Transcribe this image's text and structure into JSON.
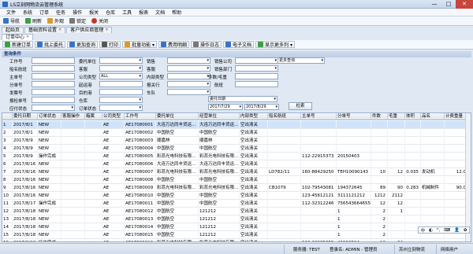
{
  "window": {
    "title": "LS立刻网物流云管理系统",
    "min": "—",
    "max": "□",
    "close": "✕"
  },
  "menu": [
    "文件",
    "系统",
    "订单",
    "任务",
    "操作",
    "报关",
    "仓库",
    "工具",
    "报表",
    "文档",
    "帮助"
  ],
  "quickbar": [
    {
      "label": "导航",
      "color": "#3a73c4"
    },
    {
      "label": "刷新",
      "color": "#3aa044"
    },
    {
      "label": "外观",
      "color": "#d99a2b"
    },
    {
      "label": "锁定",
      "color": "#777777"
    },
    {
      "label": "关闭",
      "color": "#c0392b"
    }
  ],
  "tabs_top": [
    {
      "label": "起始页",
      "closable": false
    },
    {
      "label": "基础资料设置",
      "closable": true
    },
    {
      "label": "客户供应商管理",
      "closable": true
    },
    {
      "label": "订单中心",
      "closable": true
    }
  ],
  "toolbar": [
    {
      "label": "新建订单",
      "color": "#3aa044"
    },
    {
      "label": "找上委托",
      "color": "#3a73c4"
    },
    {
      "label": "更加查询",
      "color": "#3a73c4"
    },
    {
      "label": "打印",
      "color": "#555555"
    },
    {
      "label": "批量功能 ▾",
      "color": "#d99a2b"
    },
    {
      "label": "费用明细",
      "color": "#3a73c4"
    },
    {
      "label": "操作日志",
      "color": "#777777"
    },
    {
      "label": "电子文档",
      "color": "#3a73c4"
    },
    {
      "label": "显示更多列 ▾",
      "color": "#3aa044"
    }
  ],
  "section_title": "查询条件",
  "form": {
    "labels": {
      "work_no": "工作号",
      "cust_short": "船名航班",
      "main_no": "主单号",
      "sub_no": "分单号",
      "tracking": "发票号",
      "decl_no": "报检单号",
      "sales": "应付状态",
      "consignor": "委托单位",
      "partner": "客服",
      "company_type": "公司类型",
      "origin_port": "起运港",
      "dest_port": "目的港",
      "warehouse": "仓库",
      "order_status": "订单状态",
      "sales_person": "销售",
      "operator": "客服",
      "inner_type": "内部类型",
      "decl_bank": "报关行",
      "vehicle": "车队",
      "sales_co": "销售公司",
      "sales_dept": "销售部门",
      "job_weight": "件数/毛重",
      "flight": "航班",
      "more_query": "更多查询",
      "date_type": "委托日期"
    },
    "company_type_value": "ALL",
    "date_from": "2017/7/29",
    "date_to": "2017/8/29",
    "search_button": "检索"
  },
  "table": {
    "columns": [
      "",
      "委托日期",
      "订单状态",
      "客服操作",
      "箱属",
      "公司类型",
      "工作号",
      "委托单位",
      "经营单位",
      "内部类型",
      "船名航班",
      "主单号",
      "分单号",
      "件数",
      "毛重",
      "体积",
      "品名",
      "计费重量"
    ],
    "rows": [
      [
        "1",
        "2017/8/1",
        "NEW",
        "",
        "",
        "AE",
        "AE17080001",
        "大连万达同丰货运...",
        "大连万达同丰货运...",
        "空出清关",
        "",
        "",
        "",
        "",
        "",
        "",
        "",
        ""
      ],
      [
        "2",
        "2017/8/1",
        "NEW",
        "",
        "",
        "AE",
        "AE17080002",
        "中国航空",
        "中国航空",
        "空出清关",
        "",
        "",
        "",
        "",
        "",
        "",
        "",
        ""
      ],
      [
        "3",
        "2017/8/9",
        "NEW",
        "",
        "",
        "AE",
        "AE17080003",
        "顺嘉林",
        "顺嘉林",
        "空出清关",
        "",
        "",
        "",
        "",
        "",
        "",
        "",
        ""
      ],
      [
        "4",
        "2017/8/9",
        "NEW",
        "",
        "",
        "AE",
        "AE17080004",
        "中国航空",
        "中国航空",
        "空出清关",
        "",
        "",
        "",
        "",
        "",
        "",
        "",
        ""
      ],
      [
        "5",
        "2017/8/9",
        "操作完成",
        "",
        "",
        "AE",
        "AE17080005",
        "彩蕊光电科技有限...",
        "彩蕊光电科技有限...",
        "空出清关",
        "",
        "112-22915373",
        "20150403",
        "",
        "",
        "",
        "",
        ""
      ],
      [
        "6",
        "2017/8/16",
        "NEW",
        "",
        "",
        "AE",
        "AE17080006",
        "大连万达同丰货运...",
        "大连万达同丰货运...",
        "空出清关",
        "",
        "",
        "",
        "",
        "",
        "",
        "",
        ""
      ],
      [
        "7",
        "2017/8/16",
        "NEW",
        "",
        "",
        "AE",
        "AE17080007",
        "彩蕊光电科技有限...",
        "彩蕊光电科技有限...",
        "空出清关",
        "LD782/11",
        "160-88429250",
        "TEH10090143",
        "10",
        "12",
        "0.035",
        "发动机",
        "12.0"
      ],
      [
        "8",
        "2017/8/16",
        "NEW",
        "",
        "",
        "AE",
        "AE17080008",
        "中国航空",
        "中国航空",
        "空出清关",
        "",
        "",
        "",
        "",
        "",
        "",
        "",
        ""
      ],
      [
        "9",
        "2017/8/16",
        "NEW",
        "",
        "",
        "AE",
        "AE17080009",
        "彩蕊光电科技有限...",
        "彩蕊光电科技有限...",
        "空出清关",
        "CB1079",
        "102-79543081",
        "194372645",
        "89",
        "90",
        "0.283",
        "机械制件",
        "90.0"
      ],
      [
        "10",
        "2017/8/16",
        "NEW",
        "",
        "",
        "AE",
        "AE17080010",
        "中国航空",
        "中国航空",
        "空出清关",
        "",
        "123-45612121",
        "3111121212",
        "1212",
        "2112",
        "",
        "",
        ""
      ],
      [
        "11",
        "2017/8/17",
        "操作完成",
        "",
        "",
        "AE",
        "AE17080011",
        "中国航空",
        "中国航空",
        "空出清关",
        "",
        "112-32312246",
        "756543664655",
        "12",
        "12",
        "",
        "",
        ""
      ],
      [
        "12",
        "2017/8/18",
        "NEW",
        "",
        "",
        "AE",
        "AE17080012",
        "中国航空",
        "121212",
        "空出清关",
        "",
        "",
        "1",
        "2",
        "1",
        "",
        "",
        ""
      ],
      [
        "13",
        "2017/8/18",
        "NEW",
        "",
        "",
        "AE",
        "AE17080013",
        "中国航空",
        "121212",
        "空出清关",
        "",
        "",
        "1",
        "2",
        "",
        "",
        "",
        ""
      ],
      [
        "14",
        "2017/8/18",
        "NEW",
        "",
        "",
        "AE",
        "AE17080014",
        "中国航空",
        "121212",
        "空出清关",
        "",
        "",
        "1",
        "2",
        "",
        "",
        "",
        ""
      ],
      [
        "15",
        "2017/8/18",
        "NEW",
        "",
        "",
        "AE",
        "AE17080015",
        "中国航空",
        "121212",
        "空出清关",
        "",
        "",
        "1",
        "2",
        "",
        "",
        "",
        ""
      ],
      [
        "16",
        "2017/8/18",
        "操作完成",
        "",
        "",
        "AE",
        "AE17080016",
        "彩蕊光电科技有限...",
        "彩蕊光电科技有限...",
        "空出清关",
        "",
        "112-22985055",
        "41500594",
        "13",
        "34",
        "",
        "",
        ""
      ]
    ]
  },
  "ime": [
    "中",
    "◐",
    "°,",
    "⌨",
    "👤",
    "✿"
  ],
  "status": {
    "server": "服务器: TEST",
    "user": "登录名: ADMIN - 管理员",
    "company": "苏州立刻物流",
    "mode": "网络用户"
  }
}
